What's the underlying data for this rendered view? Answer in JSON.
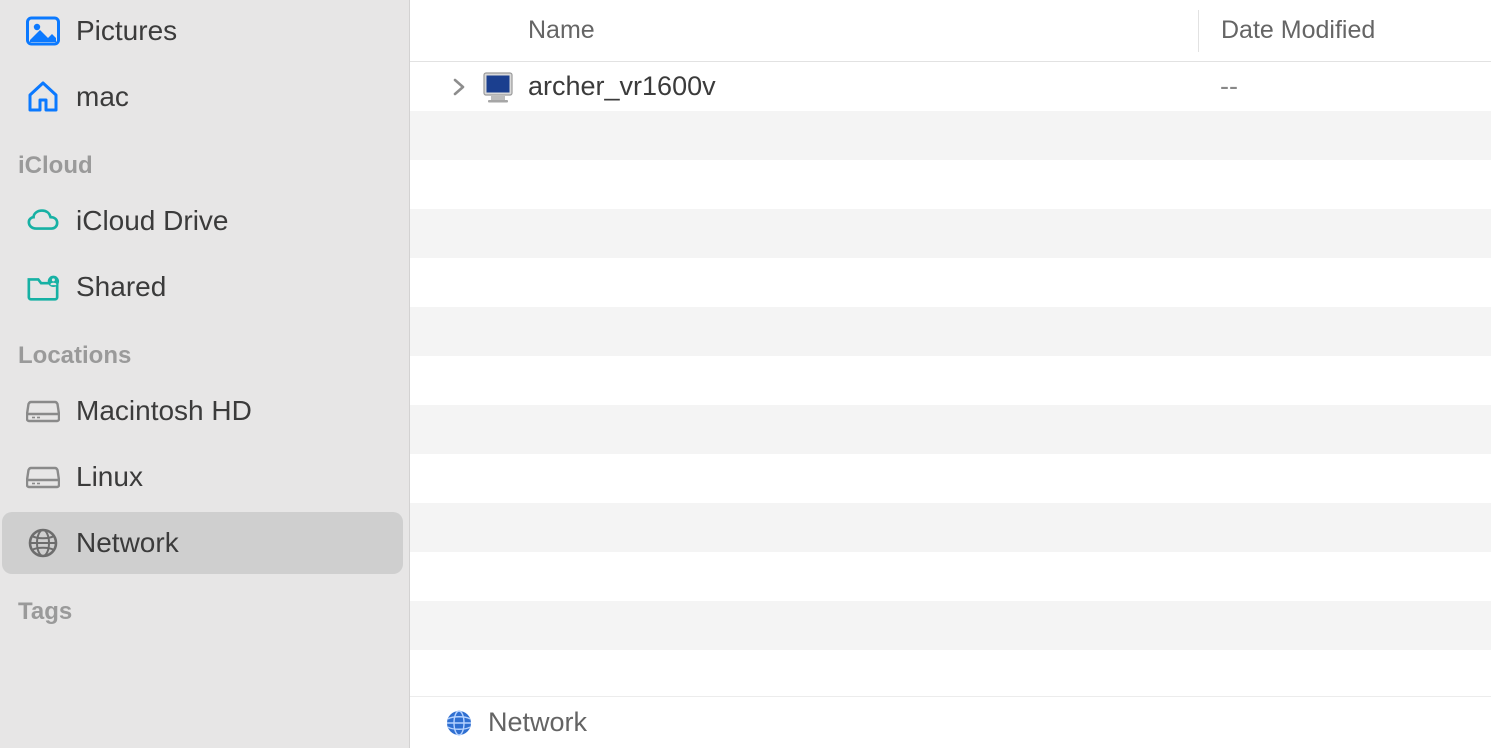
{
  "sidebar": {
    "favorites": {
      "items": [
        {
          "label": "Pictures",
          "icon": "pictures-icon",
          "color": "#0b79ff"
        },
        {
          "label": "mac",
          "icon": "home-icon",
          "color": "#0b79ff"
        }
      ]
    },
    "icloud": {
      "label": "iCloud",
      "items": [
        {
          "label": "iCloud Drive",
          "icon": "cloud-icon",
          "color": "#17b1a4"
        },
        {
          "label": "Shared",
          "icon": "shared-folder-icon",
          "color": "#17b1a4"
        }
      ]
    },
    "locations": {
      "label": "Locations",
      "items": [
        {
          "label": "Macintosh HD",
          "icon": "hdd-icon",
          "color": "#8a8a8a",
          "selected": false
        },
        {
          "label": "Linux",
          "icon": "hdd-icon",
          "color": "#8a8a8a",
          "selected": false
        },
        {
          "label": "Network",
          "icon": "globe-icon",
          "color": "#8a8a8a",
          "selected": true
        }
      ]
    },
    "tags": {
      "label": "Tags"
    }
  },
  "columns": {
    "name": "Name",
    "date_modified": "Date Modified"
  },
  "rows": [
    {
      "name": "archer_vr1600v",
      "date_modified": "--",
      "icon": "network-computer-icon",
      "expandable": true
    }
  ],
  "path_bar": {
    "icon": "network-globe-icon",
    "label": "Network"
  }
}
